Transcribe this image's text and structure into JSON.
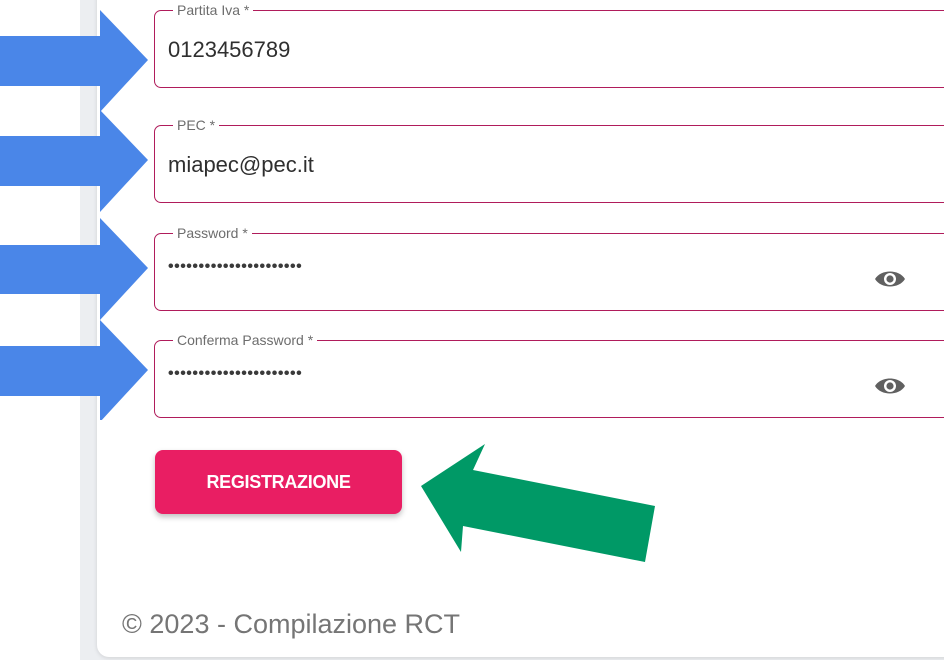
{
  "form": {
    "fields": [
      {
        "label": "Partita Iva *",
        "value": "0123456789"
      },
      {
        "label": "PEC *",
        "value": "miapec@pec.it"
      },
      {
        "label": "Password *",
        "value": "••••••••••••••••••••••",
        "icon": "eye-icon"
      },
      {
        "label": "Conferma Password *",
        "value": "••••••••••••••••••••••",
        "icon": "eye-icon"
      }
    ],
    "submit_label": "REGISTRAZIONE"
  },
  "footer": {
    "text": "© 2023 - Compilazione RCT"
  },
  "annotations": {
    "field_arrow_color": "#4a86e8",
    "button_arrow_color": "#009966"
  },
  "colors": {
    "field_border": "#b01c5b",
    "button_bg": "#e91e63"
  }
}
